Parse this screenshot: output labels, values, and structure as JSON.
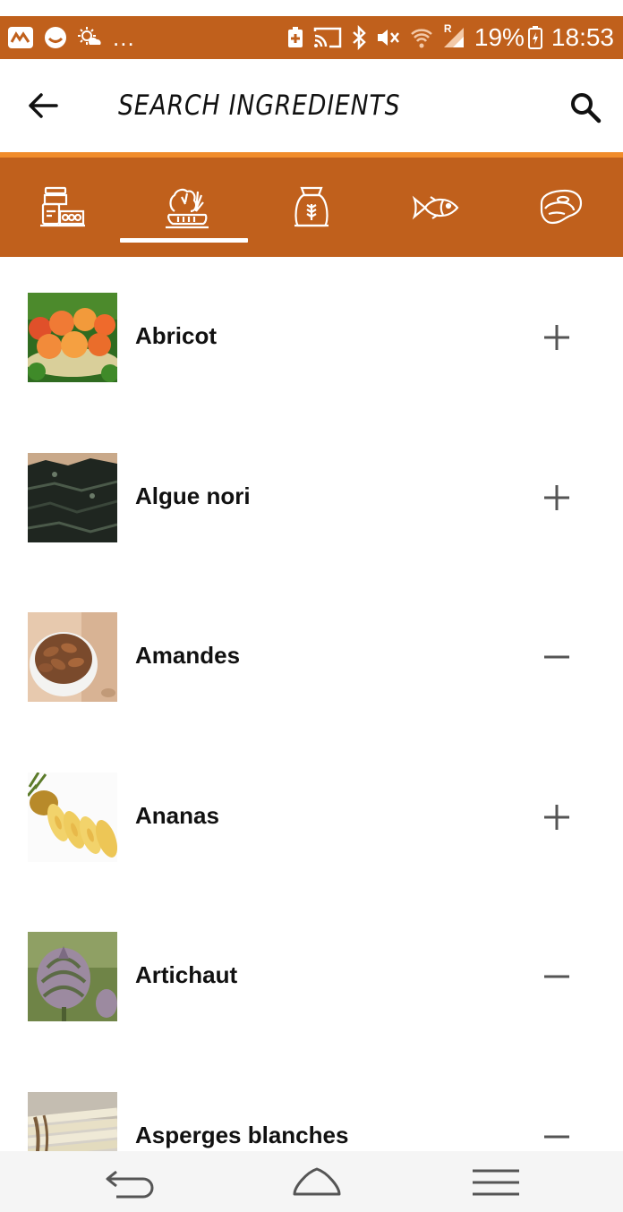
{
  "status_bar": {
    "left_icons": [
      "maps-icon",
      "messenger-icon",
      "weather-icon"
    ],
    "overflow": "...",
    "right_icons": [
      "battery-saver-icon",
      "cast-icon",
      "bluetooth-icon",
      "mute-icon",
      "wifi-icon",
      "signal-icon"
    ],
    "signal_roaming": "R",
    "battery": "19%",
    "time": "18:53"
  },
  "appbar": {
    "title": "SEARCH INGREDIENTS",
    "back_icon": "arrow-back-icon",
    "search_icon": "search-icon"
  },
  "colors": {
    "primary": "#c0601c",
    "accent_line": "#f18c2b",
    "text": "#111111",
    "action": "#555555"
  },
  "category_tabs": [
    {
      "icon": "pantry-jar-icon",
      "selected": false
    },
    {
      "icon": "vegetables-icon",
      "selected": true
    },
    {
      "icon": "grain-sack-icon",
      "selected": false
    },
    {
      "icon": "fish-icon",
      "selected": false
    },
    {
      "icon": "meat-icon",
      "selected": false
    }
  ],
  "ingredients": [
    {
      "name": "Abricot",
      "action": "add",
      "image": "apricots"
    },
    {
      "name": "Algue nori",
      "action": "add",
      "image": "nori-seaweed"
    },
    {
      "name": "Amandes",
      "action": "remove",
      "image": "almonds"
    },
    {
      "name": "Ananas",
      "action": "add",
      "image": "pineapple"
    },
    {
      "name": "Artichaut",
      "action": "remove",
      "image": "artichoke"
    },
    {
      "name": "Asperges blanches",
      "action": "remove",
      "image": "white-asparagus"
    }
  ],
  "nav": {
    "back_icon": "nav-back-icon",
    "home_icon": "nav-home-icon",
    "menu_icon": "nav-menu-icon"
  }
}
